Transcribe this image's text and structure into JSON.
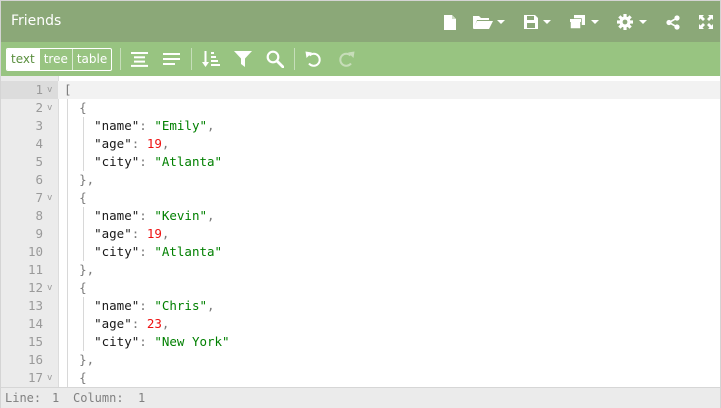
{
  "window": {
    "title": "Friends"
  },
  "title_icons": [
    "new-document-icon",
    "open-folder-icon",
    "save-icon",
    "copy-windows-icon",
    "settings-gear-icon",
    "share-icon",
    "fullscreen-icon"
  ],
  "modes": {
    "text": "text",
    "tree": "tree",
    "table": "table",
    "active": "text"
  },
  "toolbar_icons": [
    "format-icon",
    "compact-icon",
    "sort-icon",
    "filter-icon",
    "search-icon",
    "undo-icon",
    "redo-icon"
  ],
  "editor": {
    "lines": [
      {
        "num": "1",
        "fold": "v"
      },
      {
        "num": "2",
        "fold": "v"
      },
      {
        "num": "3",
        "fold": ""
      },
      {
        "num": "4",
        "fold": ""
      },
      {
        "num": "5",
        "fold": ""
      },
      {
        "num": "6",
        "fold": ""
      },
      {
        "num": "7",
        "fold": "v"
      },
      {
        "num": "8",
        "fold": ""
      },
      {
        "num": "9",
        "fold": ""
      },
      {
        "num": "10",
        "fold": ""
      },
      {
        "num": "11",
        "fold": ""
      },
      {
        "num": "12",
        "fold": "v"
      },
      {
        "num": "13",
        "fold": ""
      },
      {
        "num": "14",
        "fold": ""
      },
      {
        "num": "15",
        "fold": ""
      },
      {
        "num": "16",
        "fold": ""
      },
      {
        "num": "17",
        "fold": "v"
      }
    ],
    "tokens": {
      "open_bracket": "[",
      "open_brace": "{",
      "close_brace_comma": "},",
      "colon": ": ",
      "comma": ",",
      "key_name": "\"name\"",
      "key_age": "\"age\"",
      "key_city": "\"city\""
    },
    "records": [
      {
        "name": "\"Emily\"",
        "age": "19",
        "city": "\"Atlanta\""
      },
      {
        "name": "\"Kevin\"",
        "age": "19",
        "city": "\"Atlanta\""
      },
      {
        "name": "\"Chris\"",
        "age": "23",
        "city": "\"New York\""
      }
    ]
  },
  "status": {
    "line_label": "Line:",
    "line_value": "1",
    "column_label": "Column:",
    "column_value": "1"
  },
  "colors": {
    "title_bar": "#8ba878",
    "toolbar": "#98c481",
    "string": "#008000",
    "number": "#ee1111"
  }
}
